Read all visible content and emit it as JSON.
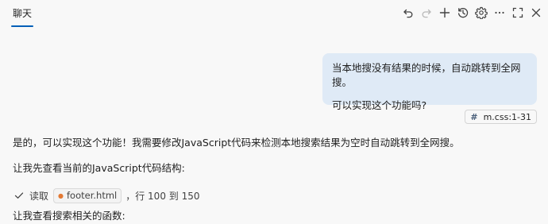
{
  "header": {
    "tab_label": "聊天",
    "icons": [
      "undo-icon",
      "redo-icon",
      "plus-icon",
      "history-icon",
      "gear-icon",
      "ellipsis-icon",
      "maximize-icon",
      "close-icon"
    ]
  },
  "conversation": {
    "user_message": {
      "line1": "当本地搜没有结果的时候，自动跳转到全网搜。",
      "line2": "可以实现这个功能吗?"
    },
    "reference_chip": {
      "icon": "#",
      "label": "m.css:1-31"
    },
    "assistant": {
      "line1": "是的，可以实现这个功能！我需要修改JavaScript代码来检测本地搜索结果为空时自动跳转到全网搜。",
      "line2": "让我先查看当前的JavaScript代码结构:",
      "tool_action": "读取",
      "tool_file": "footer.html",
      "tool_range": "，行 100 到 150",
      "line3": "让我查看搜索相关的函数:"
    }
  },
  "colors": {
    "accent": "#005fb8",
    "bubble_bg": "#dfeaf6",
    "background": "#f8f8f8"
  }
}
